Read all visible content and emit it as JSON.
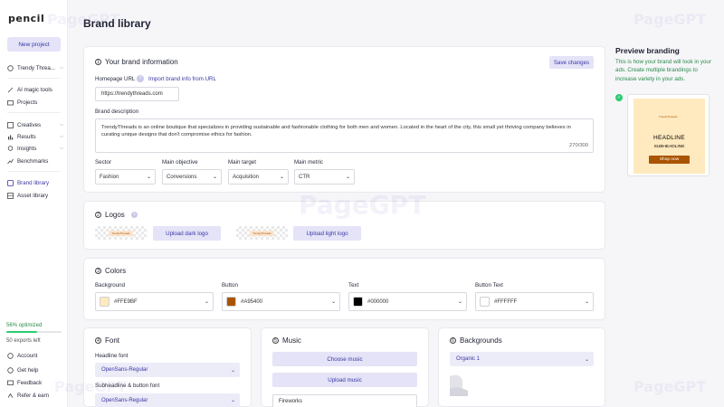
{
  "app": {
    "logo_text": "pencil",
    "new_project": "New project",
    "watermark": "PageGPT"
  },
  "sidebar": {
    "workspace": "Trendy Threa...",
    "items": [
      {
        "label": "AI magic tools"
      },
      {
        "label": "Projects"
      },
      {
        "label": "Creatives"
      },
      {
        "label": "Results"
      },
      {
        "label": "Insights"
      },
      {
        "label": "Benchmarks"
      },
      {
        "label": "Brand library"
      },
      {
        "label": "Asset library"
      }
    ],
    "optimized": "56% optimized",
    "optimized_fraction": 0.56,
    "exports": "50 exports left",
    "bottom": [
      {
        "label": "Account"
      },
      {
        "label": "Get help"
      },
      {
        "label": "Feedback"
      },
      {
        "label": "Refer & earn"
      }
    ]
  },
  "page": {
    "title": "Brand library"
  },
  "brand_info": {
    "title": "Your brand information",
    "number": "1",
    "save": "Save changes",
    "homepage_label": "Homepage URL",
    "import_link": "Import brand info from URL",
    "homepage_value": "https://trendythreads.com",
    "description_label": "Brand description",
    "description": "TrendyThreads is an online boutique that specializes in providing sustainable and fashionable clothing for both men and women. Located in the heart of the city, this small yet thriving company believes in curating unique designs that don't compromise ethics for fashion.",
    "char_count": "270/300",
    "sector_label": "Sector",
    "sector_value": "Fashion",
    "objective_label": "Main objective",
    "objective_value": "Conversions",
    "target_label": "Main target",
    "target_value": "Acquisition",
    "metric_label": "Main metric",
    "metric_value": "CTR"
  },
  "logos": {
    "title": "Logos",
    "number": "2",
    "upload_dark": "Upload dark logo",
    "upload_light": "Upload light logo",
    "logo_mark": "TrendyThreads"
  },
  "colors": {
    "title": "Colors",
    "number": "3",
    "fields": [
      {
        "label": "Background",
        "value": "#FFE9BF",
        "swatch": "#FFE9BF"
      },
      {
        "label": "Button",
        "value": "#A95400",
        "swatch": "#A95400"
      },
      {
        "label": "Text",
        "value": "#000000",
        "swatch": "#000000"
      },
      {
        "label": "Button Text",
        "value": "#FFFFFF",
        "swatch": "#FFFFFF"
      }
    ]
  },
  "font": {
    "title": "Font",
    "number": "4",
    "headline_label": "Headline font",
    "headline_value": "OpenSans-Regular",
    "sub_label": "Subheadline & button font",
    "sub_value": "OpenSans-Regular"
  },
  "music": {
    "title": "Music",
    "number": "5",
    "choose": "Choose music",
    "upload": "Upload music",
    "track": "Fireworks"
  },
  "backgrounds": {
    "title": "Backgrounds",
    "number": "6",
    "value": "Organic 1"
  },
  "preview": {
    "title": "Preview branding",
    "text": "This is how your brand will look in your ads. Create multiple brandings to increase variety in your ads.",
    "logo": "TrendyThreads",
    "headline": "HEADLINE",
    "subheadline": "SUBHEADLINE",
    "button": "Shop now"
  }
}
